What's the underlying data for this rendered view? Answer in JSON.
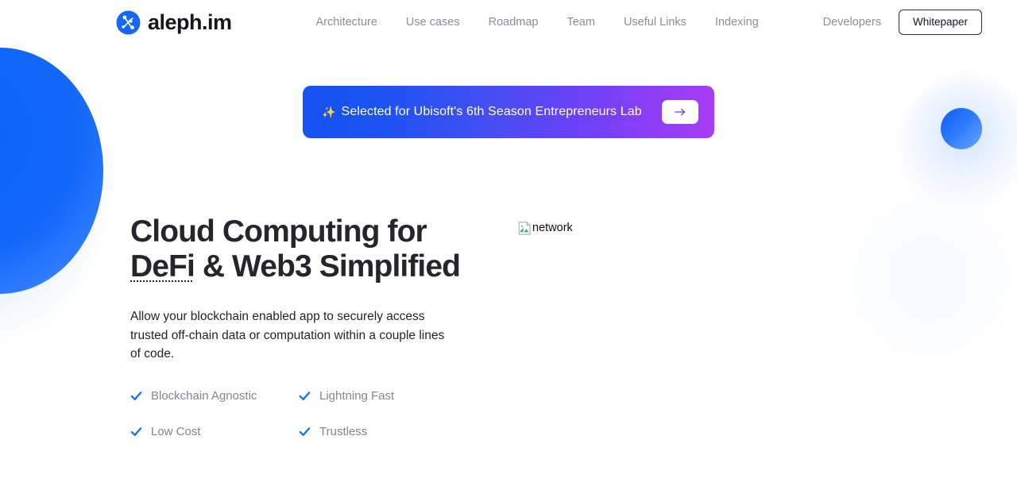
{
  "brand": {
    "name": "aleph.im",
    "logo_icon": "aleph-node-graph-icon",
    "logo_color": "#1667F5"
  },
  "header": {
    "nav": [
      {
        "label": "Architecture"
      },
      {
        "label": "Use cases"
      },
      {
        "label": "Roadmap"
      },
      {
        "label": "Team"
      },
      {
        "label": "Useful Links"
      },
      {
        "label": "Indexing"
      }
    ],
    "developers_label": "Developers",
    "whitepaper_label": "Whitepaper"
  },
  "announcement": {
    "sparkle_icon": "✨",
    "text": "Selected for Ubisoft's 6th Season Entrepreneurs Lab",
    "cta_icon": "arrow-right-icon",
    "gradient_start": "#1653F2",
    "gradient_end": "#A93CF5"
  },
  "hero": {
    "title_line1": "Cloud Computing for",
    "title_abbr": "DeFi",
    "title_line2_rest": " & Web3 Simplified",
    "subtitle": "Allow your blockchain enabled app to securely access trusted off-chain data or computation within a couple lines of code.",
    "features": [
      {
        "label": "Blockchain Agnostic",
        "icon": "check-icon"
      },
      {
        "label": "Lightning Fast",
        "icon": "check-icon"
      },
      {
        "label": "Low Cost",
        "icon": "check-icon"
      },
      {
        "label": "Trustless",
        "icon": "check-icon"
      }
    ],
    "check_color": "#1A73E8",
    "media_alt": "network"
  }
}
